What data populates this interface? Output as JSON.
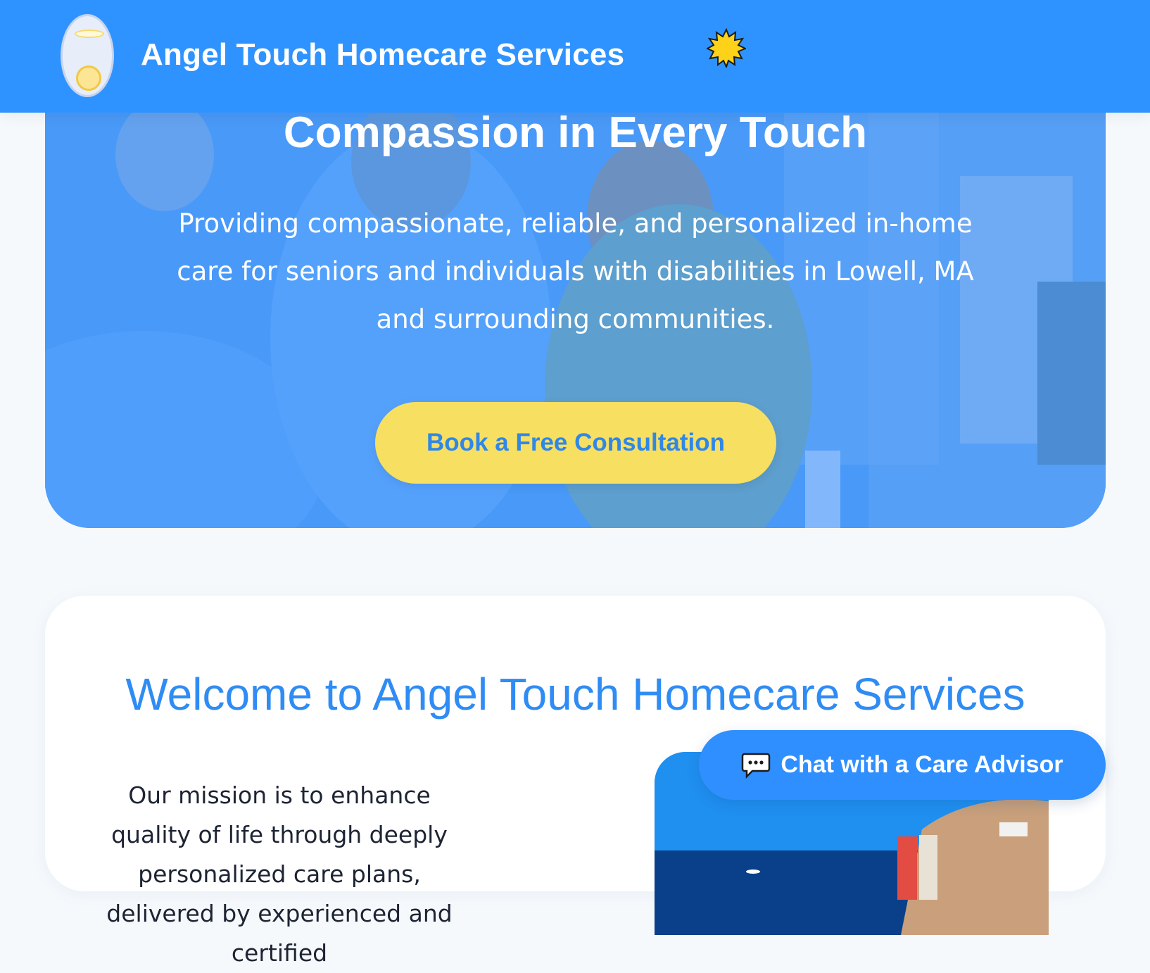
{
  "header": {
    "brand_title": "Angel Touch Homecare Services",
    "logo_icon": "angel-halo-logo",
    "decor_icon": "sun-icon"
  },
  "hero": {
    "heading": "Compassion in Every Touch",
    "text": "Providing compassionate, reliable, and personalized in-home care for seniors and individuals with disabilities in Lowell, MA and surrounding communities.",
    "cta_label": "Book a Free Consultation"
  },
  "welcome": {
    "heading": "Welcome to Angel Touch Homecare Services",
    "mission": "Our mission is to enhance quality of life through deeply personalized care plans, delivered by experienced and certified"
  },
  "chat": {
    "label": "Chat with a Care Advisor",
    "icon": "chat-bubble-icon"
  },
  "colors": {
    "primary": "#2f93ff",
    "accent": "#f7df61",
    "background": "#f6f9fc",
    "heading_blue": "#2f8cf4",
    "text_dark": "#1d2433"
  }
}
